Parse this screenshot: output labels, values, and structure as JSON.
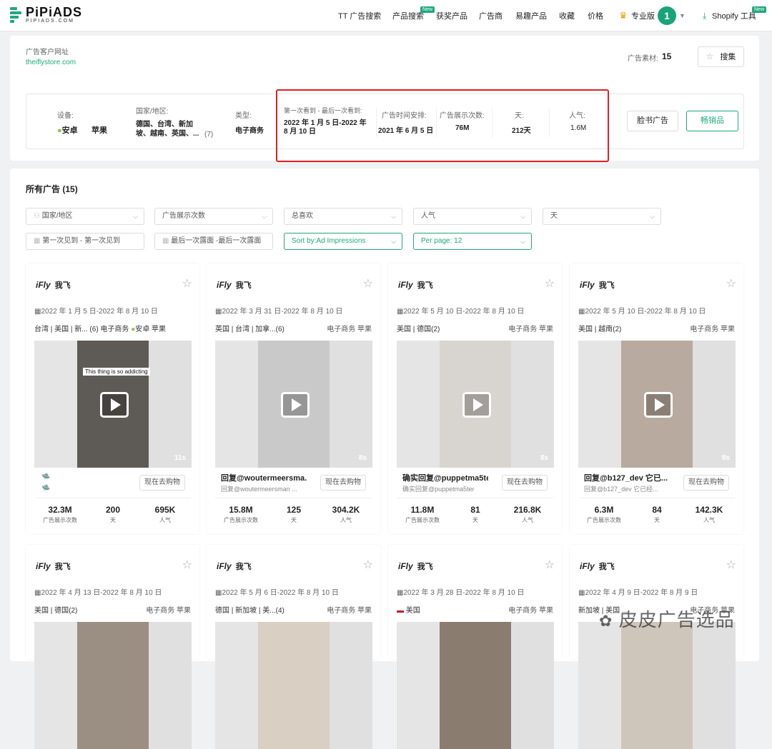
{
  "nav": {
    "logo_text": "PiPiADS",
    "logo_sub": "PIPIADS.COM",
    "items": [
      "TT 广告搜索",
      "产品搜索",
      "获奖产品",
      "广告商",
      "易趣产品",
      "收藏",
      "价格"
    ],
    "new_badge": "New",
    "pro_label": "专业版",
    "avatar": "1",
    "shopify": "Shopify 工具"
  },
  "advertiser": {
    "url_label": "广告客户网址",
    "url": "theiflystore.com",
    "ad_count_label": "广告素材:",
    "ad_count": "15",
    "collect_label": "搜集"
  },
  "summary": {
    "device_label": "设备:",
    "android": "安卓",
    "apple": "苹果",
    "region_label": "国家/地区:",
    "regions": "德国、台湾、新加坡、越南、英国、...",
    "region_count": "(7)",
    "type_label": "类型:",
    "type": "电子商务",
    "seen_label": "第一次看到 - 最后一次看到:",
    "seen": "2022 年 1 月 5 日-2022 年 8 月 10 日",
    "schedule_label": "广告时间安排:",
    "schedule": "2021 年 6 月 5 日",
    "impressions_label": "广告展示次数:",
    "impressions": "76M",
    "days_label": "天:",
    "days": "212天",
    "popularity_label": "人气:",
    "popularity": "1.6M",
    "fb_button": "脸书广告",
    "bestseller_button": "畅销品"
  },
  "all_ads": {
    "title": "所有广告",
    "count": "(15)",
    "filters_row1": [
      "国家/地区",
      "广告展示次数",
      "总喜欢",
      "人气",
      "天"
    ],
    "filter_first_seen": "第一次见到  - 第一次见到",
    "filter_last_seen": "最后一次露面 -最后一次露面",
    "sort": "Sort by:Ad Impressions",
    "per_page": "Per page:  12"
  },
  "ads": [
    {
      "brand": "我飞",
      "date": "2022 年 1 月 5 日-2022 年 8 月 10 日",
      "tags": "台湾 | 美国 | 新...    (6)  电子商务",
      "tr_a": "安卓",
      "tr_b": "苹果",
      "title": "",
      "sub": "",
      "caption": "This thing is so addicting",
      "duration": "11s",
      "shop": "现在去购物",
      "impressions": "32.3M",
      "days": "200",
      "popularity": "695K",
      "k1": "广告展示次数",
      "k2": "天",
      "k3": "人气"
    },
    {
      "brand": "我飞",
      "date": "2022 年 3 月 31 日-2022 年 8 月 10 日",
      "tags": "英国 | 台湾 | 加拿...(6)",
      "tr_a": "电子商务",
      "tr_b": "苹果",
      "title": "回复@woutermeersma...",
      "sub": "回复@woutermeersman ...",
      "caption": "",
      "duration": "8s",
      "shop": "现在去购物",
      "impressions": "15.8M",
      "days": "125",
      "popularity": "304.2K",
      "k1": "广告展示次数",
      "k2": "天",
      "k3": "人气"
    },
    {
      "brand": "我飞",
      "date": "2022 年 5 月 10 日-2022 年 8 月 10 日",
      "tags": "美国 | 德国(2)",
      "tr_a": "电子商务",
      "tr_b": "苹果",
      "title": "确实回复@puppetma5ter",
      "sub": "确实回复@puppetma5ter",
      "caption": "",
      "duration": "8s",
      "shop": "现在去购物",
      "impressions": "11.8M",
      "days": "81",
      "popularity": "216.8K",
      "k1": "广告展示次数",
      "k2": "天",
      "k3": "人气"
    },
    {
      "brand": "我飞",
      "date": "2022 年 5 月 10 日-2022 年 8 月 10 日",
      "tags": "美国 | 越南(2)",
      "tr_a": "电子商务",
      "tr_b": "苹果",
      "title": "回复@b127_dev 它已...",
      "sub": "回复@b127_dev 它已经...",
      "caption": "",
      "duration": "8s",
      "shop": "现在去购物",
      "impressions": "6.3M",
      "days": "84",
      "popularity": "142.3K",
      "k1": "广告展示次数",
      "k2": "天",
      "k3": "人气"
    },
    {
      "brand": "我飞",
      "date": "2022 年 4 月 13 日-2022 年 8 月 10 日",
      "tags": "美国 | 德国(2)",
      "tr_a": "电子商务",
      "tr_b": "苹果"
    },
    {
      "brand": "我飞",
      "date": "2022 年 5 月 6 日-2022 年 8 月 10 日",
      "tags": "德国 | 新加坡 | 美...(4)",
      "tr_a": "电子商务",
      "tr_b": "苹果"
    },
    {
      "brand": "我飞",
      "date": "2022 年 3 月 28 日-2022 年 8 月 10 日",
      "tags": "美国",
      "tr_a": "电子商务",
      "tr_b": "苹果"
    },
    {
      "brand": "我飞",
      "date": "2022 年 4 月 9 日-2022 年 8 月 9 日",
      "tags": "新加坡 | 美国 ...",
      "tr_a": "电子商务",
      "tr_b": "苹果"
    }
  ],
  "watermark": "皮皮广告选品",
  "colors": {
    "accent": "#1fa97a",
    "highlight": "#e02020"
  }
}
